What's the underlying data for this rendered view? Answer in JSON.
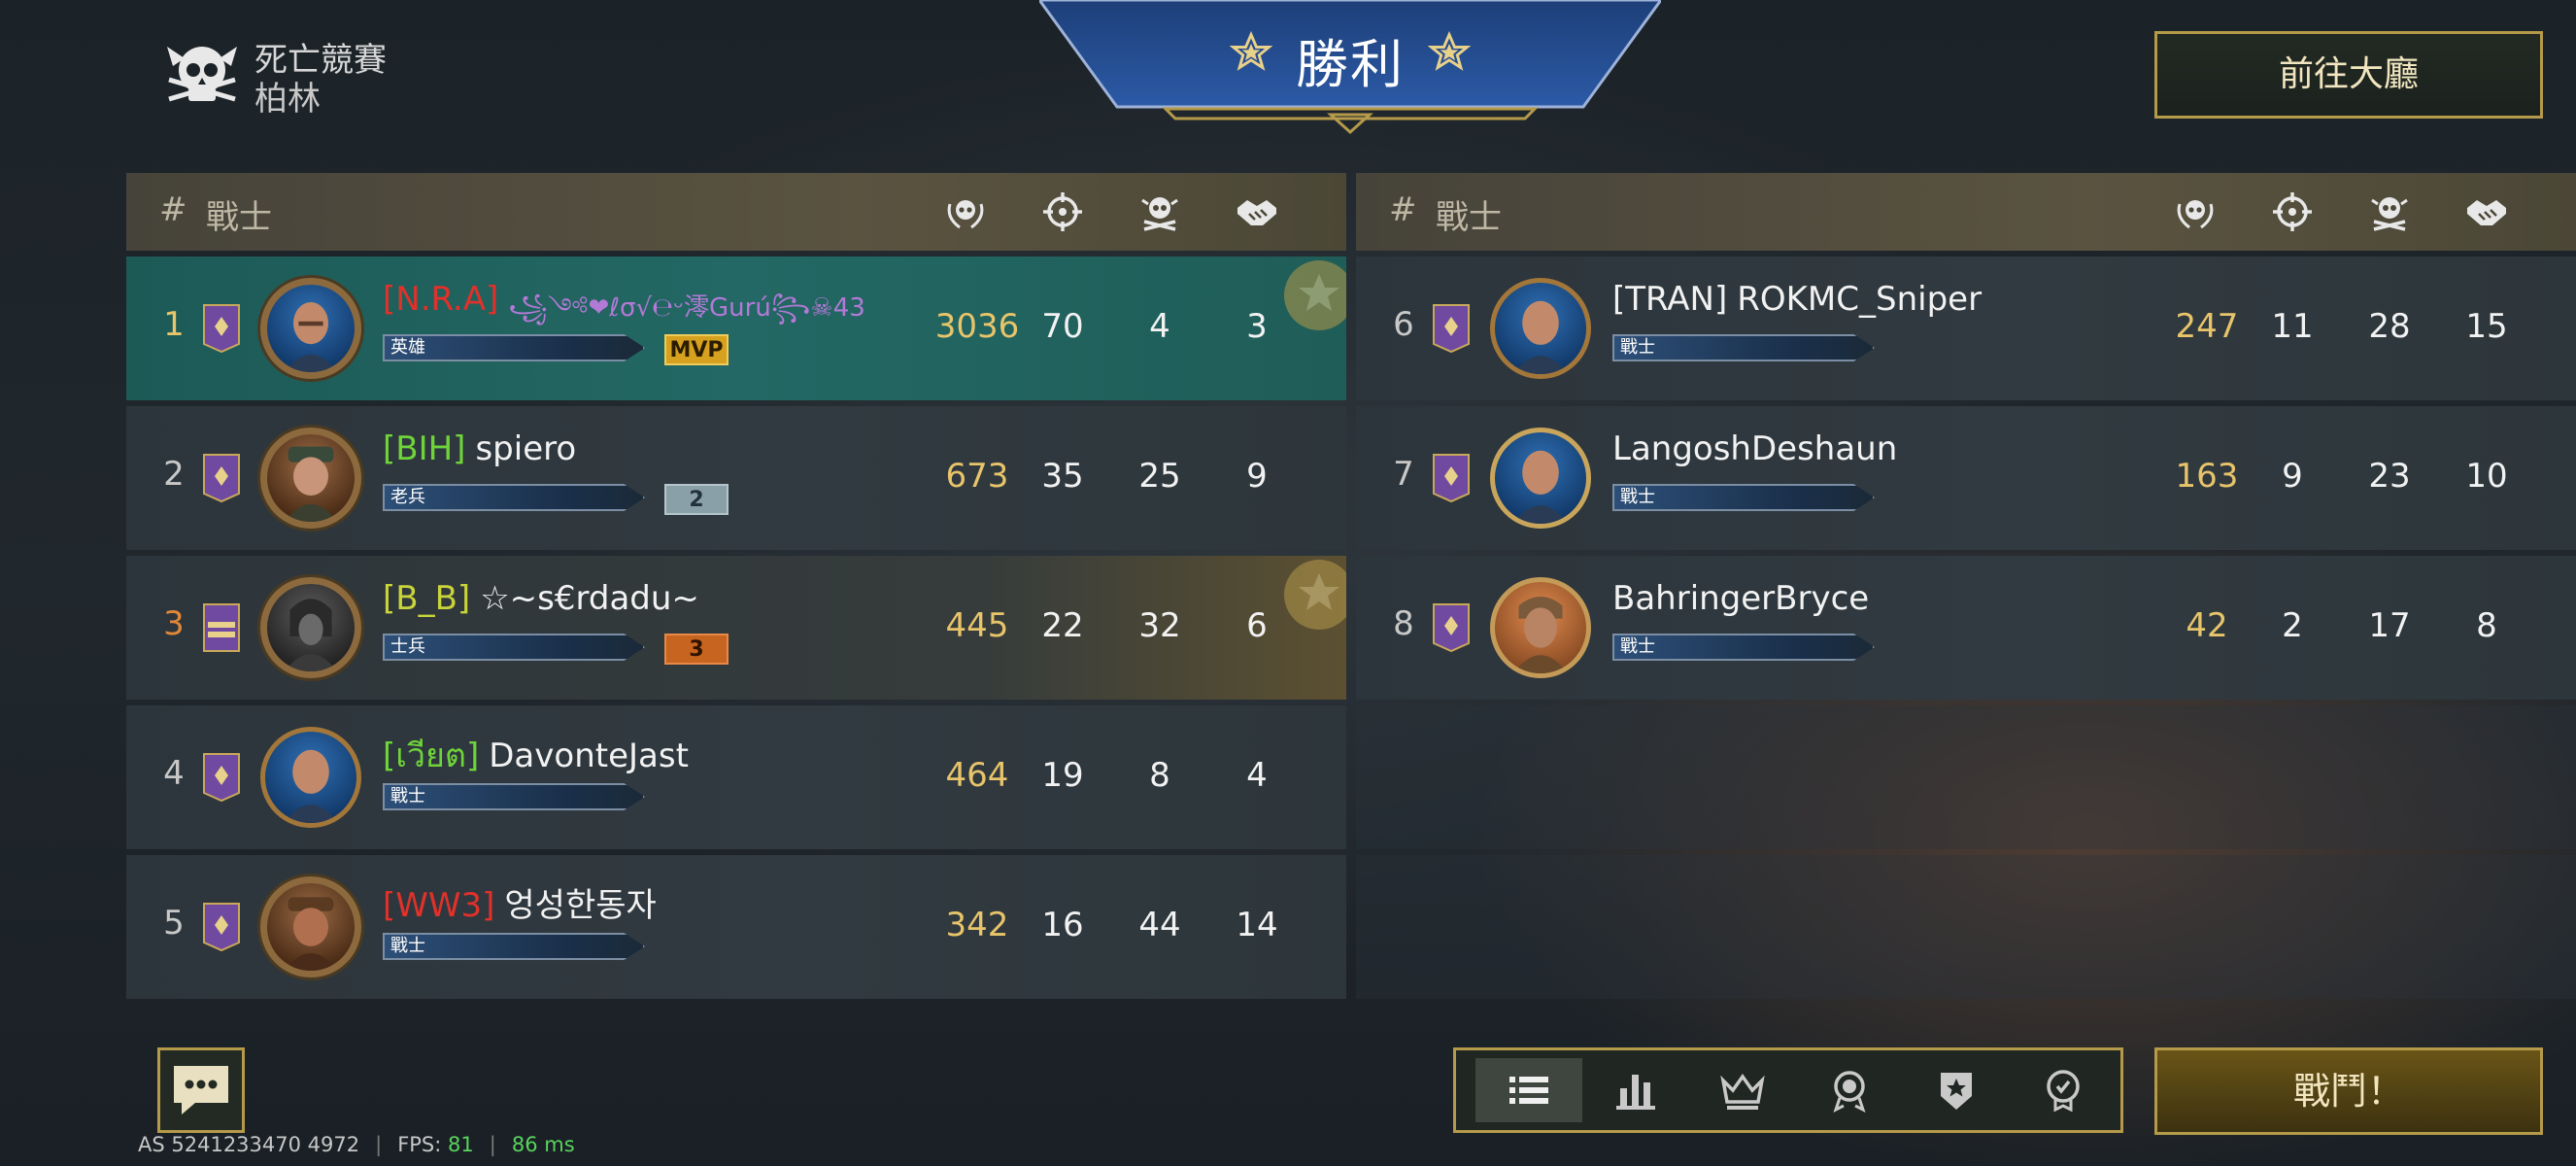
{
  "header": {
    "mode_title": "死亡競賽",
    "map_name": "柏林",
    "result": "勝利",
    "lobby_button": "前往大廳",
    "battle_button": "戰鬥！"
  },
  "columns": {
    "hash": "#",
    "warrior": "戰士"
  },
  "icons": {
    "mode": "skull-icon",
    "score": "laurel-skull-icon",
    "kills": "crosshair-icon",
    "deaths": "skull-crossbones-icon",
    "assists": "handshake-icon"
  },
  "left_team": [
    {
      "rank": "1",
      "tag": "[N.R.A]",
      "tag_color": "#e0312a",
      "name": "",
      "fancy": "꧁༺❤ℓσ√℮ᵕ澪Gurú꧂☠43",
      "title": "英雄",
      "chip": "MVP",
      "score": "3036",
      "kills": "70",
      "deaths": "4",
      "assists": "3"
    },
    {
      "rank": "2",
      "tag": "[BIH]",
      "tag_color": "#6fd43a",
      "name": "spiero",
      "title": "老兵",
      "chip": "2",
      "score": "673",
      "kills": "35",
      "deaths": "25",
      "assists": "9"
    },
    {
      "rank": "3",
      "tag": "[B_B]",
      "tag_color": "#c9d43a",
      "name": "☆~s€rdadu~",
      "title": "士兵",
      "chip": "3",
      "score": "445",
      "kills": "22",
      "deaths": "32",
      "assists": "6"
    },
    {
      "rank": "4",
      "tag": "[เวียต]",
      "tag_color": "#6fd43a",
      "name": "DavonteJast",
      "title": "戰士",
      "score": "464",
      "kills": "19",
      "deaths": "8",
      "assists": "4"
    },
    {
      "rank": "5",
      "tag": "[WW3]",
      "tag_color": "#e0312a",
      "name": "엉성한동자",
      "title": "戰士",
      "score": "342",
      "kills": "16",
      "deaths": "44",
      "assists": "14"
    }
  ],
  "right_team": [
    {
      "rank": "6",
      "tag": "[TRAN]",
      "tag_color": "#f2f2f2",
      "name": "ROKMC_Sniper",
      "title": "戰士",
      "score": "247",
      "kills": "11",
      "deaths": "28",
      "assists": "15"
    },
    {
      "rank": "7",
      "tag": "",
      "tag_color": "#f2f2f2",
      "name": "LangoshDeshaun",
      "title": "戰士",
      "score": "163",
      "kills": "9",
      "deaths": "23",
      "assists": "10"
    },
    {
      "rank": "8",
      "tag": "",
      "tag_color": "#f2f2f2",
      "name": "BahringerBryce",
      "title": "戰士",
      "score": "42",
      "kills": "2",
      "deaths": "17",
      "assists": "8"
    }
  ],
  "footer": {
    "account": "AS 5241233470 4972",
    "fps_label": "FPS:",
    "fps_value": "81",
    "ping": "86 ms"
  },
  "tabs": [
    "list-icon",
    "bar-chart-icon",
    "crown-icon",
    "medal-icon",
    "shield-star-icon",
    "award-icon"
  ]
}
